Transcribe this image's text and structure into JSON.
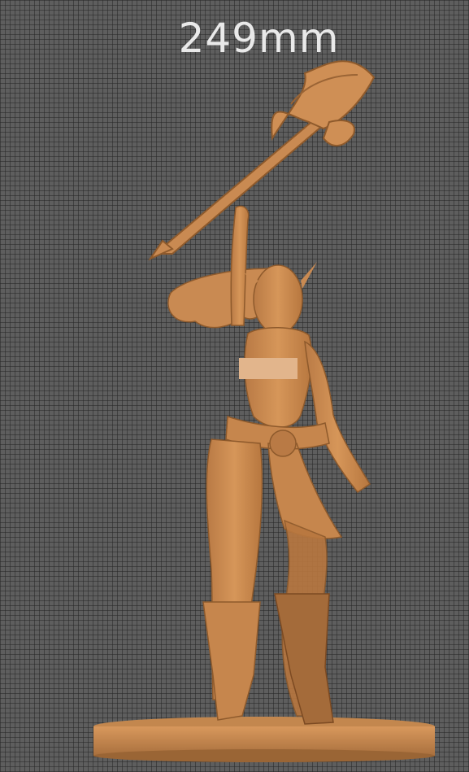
{
  "viewport": {
    "dimension_label": "249mm"
  },
  "colors": {
    "background": "#5e5e5e",
    "grid": "#3a3a3a",
    "model": "#d08f55",
    "model_shadow": "#9e6536",
    "censor_bar": "#e2b58c"
  }
}
